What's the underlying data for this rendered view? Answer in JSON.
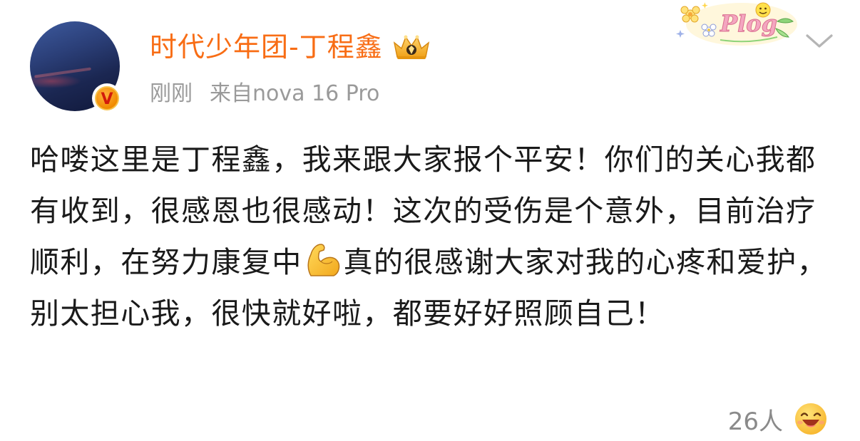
{
  "post": {
    "author_name": "时代少年团-丁程鑫",
    "time": "刚刚",
    "source": "来自nova 16 Pro",
    "verified_badge_letter": "V",
    "body_part1": "哈喽这里是丁程鑫，我来跟大家报个平安！你们的关心我都有收到，很感恩也很感动！这次的受伤是个意外，目前治疗顺利，在努力康复中",
    "body_emoji": "flexed-biceps",
    "body_part2": "真的很感谢大家对我的心疼和爱护，别太担心我，很快就好啦，都要好好照顾自己！",
    "sticker_text": "Plog",
    "like_count": "26人"
  },
  "colors": {
    "author_name": "#f86d15",
    "meta_text": "#9a9a9a",
    "body_text": "#1a1a1a",
    "badge_orange": "#f08a00",
    "badge_letter_red": "#d21b0b"
  },
  "icons": {
    "crown": "crown-icon",
    "chevron": "chevron-down-icon",
    "sticker": "plog-sticker",
    "muscle": "flexed-biceps-emoji",
    "reaction": "laughing-face-icon"
  }
}
